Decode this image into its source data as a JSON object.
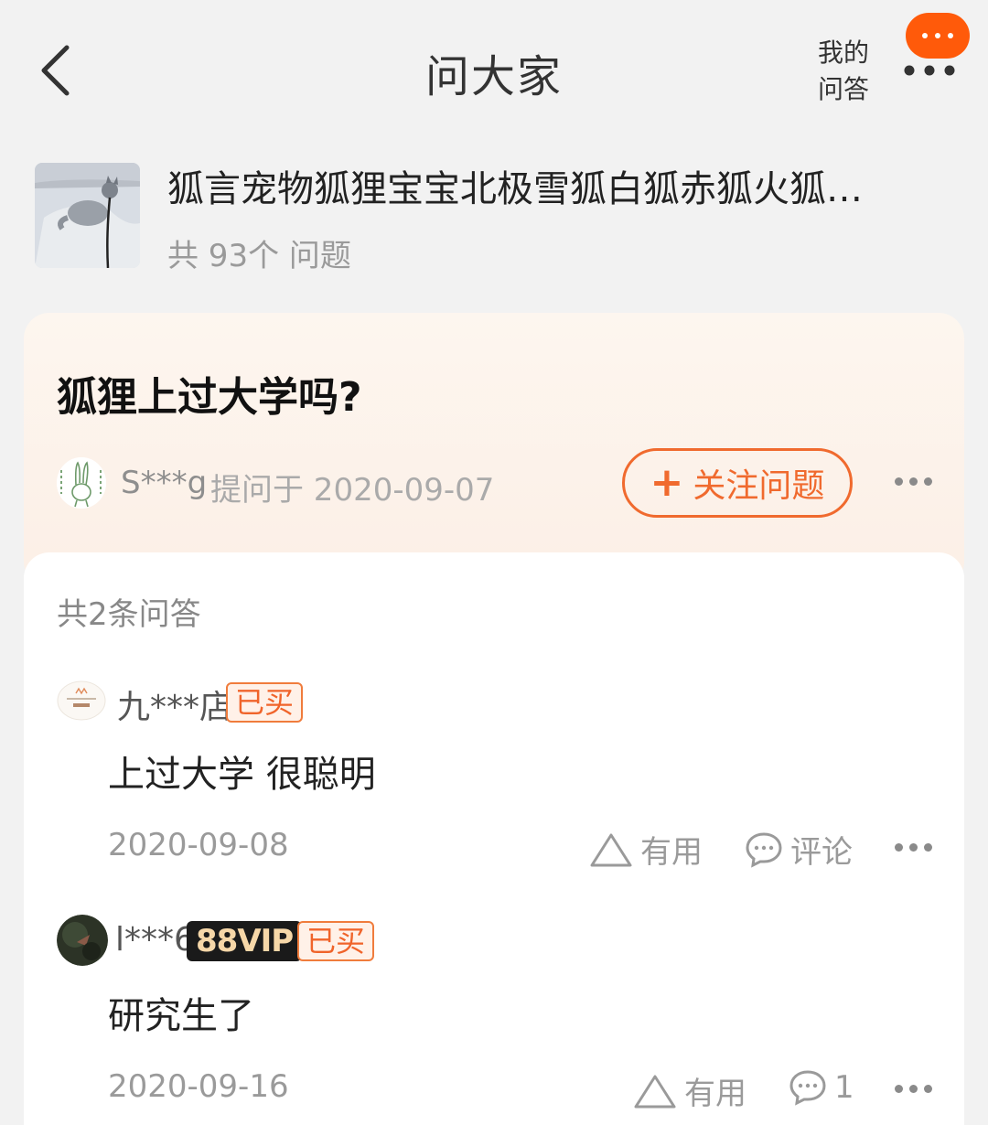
{
  "header": {
    "title": "问大家",
    "my_qa_line1": "我的",
    "my_qa_line2": "问答"
  },
  "product": {
    "title": "狐言宠物狐狸宝宝北极雪狐白狐赤狐火狐…",
    "count": "共 93个 问题"
  },
  "question": {
    "title": "狐狸上过大学吗?",
    "asker": "S***g",
    "asked_at": "提问于 2020-09-07",
    "follow_label": "关注问题"
  },
  "answers_header": "共2条问答",
  "answers": [
    {
      "user": "九***店",
      "badge_bought": "已买",
      "text": "上过大学 很聪明",
      "date": "2020-09-08",
      "useful_label": "有用",
      "comment_label": "评论"
    },
    {
      "user": "l***6",
      "badge_vip": "88VIP",
      "badge_bought": "已买",
      "text": "研究生了",
      "date": "2020-09-16",
      "useful_label": "有用",
      "comment_label": "1"
    }
  ],
  "colors": {
    "accent": "#f06a2e",
    "notification": "#ff5a0a",
    "question_card_bg": "#fdf6ef"
  }
}
